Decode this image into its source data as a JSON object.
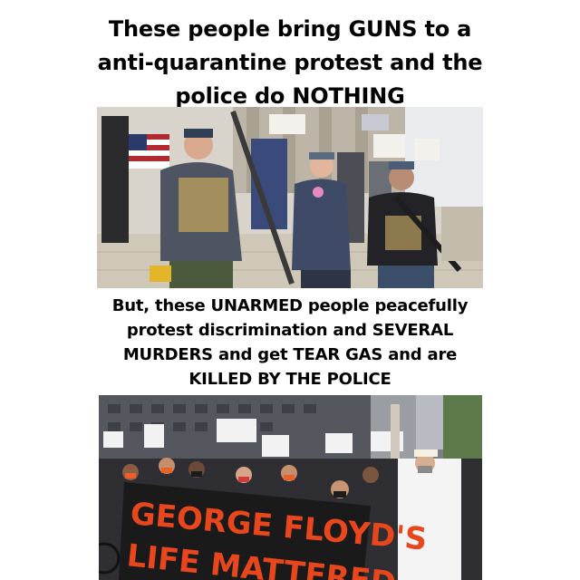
{
  "headline_top": {
    "lines": [
      "These people bring GUNS to a",
      "anti-quarantine protest and the",
      "police do NOTHING"
    ]
  },
  "headline_bottom": {
    "lines": [
      "But, these UNARMED people peacefully",
      "protest discrimination and SEVERAL",
      "MURDERS and get TEAR GAS and are",
      "KILLED BY THE POLICE"
    ]
  },
  "photo_bottom": {
    "banner_line_1": "GEORGE FLOYD'S",
    "banner_line_2": "LIFE MATTERED",
    "colors": {
      "banner_bg": "#1a1a1a",
      "banner_text": "#e8461c"
    }
  },
  "photo_top": {
    "colors": {
      "sky": "#e9ebee",
      "steps": "#cfc7b8",
      "flag_red": "#b02a2f",
      "flag_blue": "#2b3a6b"
    }
  }
}
